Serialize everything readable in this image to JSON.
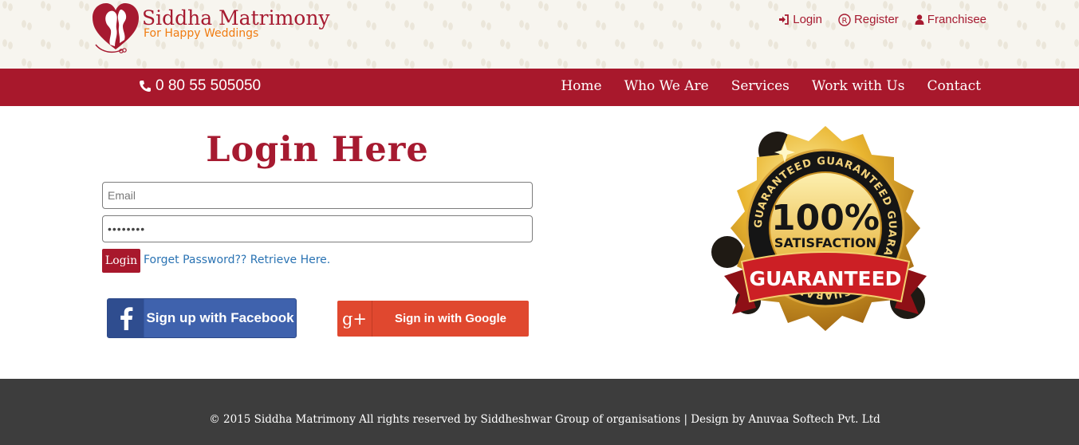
{
  "brand": {
    "title": "Siddha Matrimony",
    "tagline": "For Happy Weddings",
    "primary_color": "#a8182c",
    "accent_color": "#f07c12"
  },
  "top_links": [
    {
      "label": "Login",
      "icon": "sign-in-icon"
    },
    {
      "label": "Register",
      "icon": "registered-icon"
    },
    {
      "label": "Franchisee",
      "icon": "user-icon"
    }
  ],
  "navbar": {
    "phone": "0 80 55 505050",
    "items": [
      "Home",
      "Who We Are",
      "Services",
      "Work with Us",
      "Contact"
    ]
  },
  "login": {
    "title": "Login Here",
    "email_placeholder": "Email",
    "password_value": "********",
    "submit_label": "Login",
    "forgot_text": "Forget Password?? Retrieve Here.",
    "facebook_label": "Sign up with Facebook",
    "google_label": "Sign in with Google",
    "facebook_color": "#3f62ad",
    "google_color": "#e0482f"
  },
  "badge": {
    "ring_text": "GUARANTEED GUARANTEED GUARANTEED GUARANTEED",
    "percent": "100%",
    "subtitle": "SATISFACTION",
    "banner": "GUARANTEED"
  },
  "footer": {
    "copyright": "© 2015 Siddha Matrimony All rights reserved by Siddheshwar Group of organisations | Design by Anuvaa Softech Pvt. Ltd",
    "background": "#3d3d3d"
  }
}
